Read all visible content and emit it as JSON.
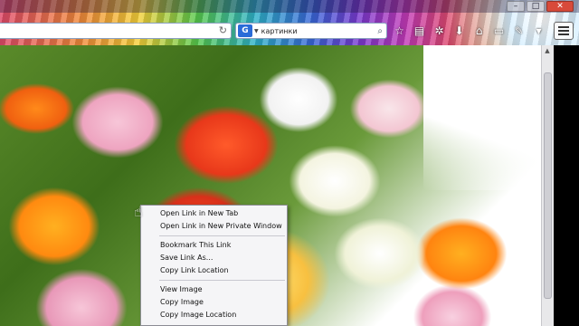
{
  "browser": {
    "window_controls": [
      "–",
      "□",
      "✕"
    ]
  },
  "search": {
    "engine_icon_label": "G",
    "value": "картинки",
    "engine_icon": "google-icon"
  },
  "toolbar_icons": [
    {
      "name": "star-icon",
      "glyph": "☆"
    },
    {
      "name": "clipboard-icon",
      "glyph": "▤"
    },
    {
      "name": "gear-icon",
      "glyph": "✲"
    },
    {
      "name": "download-icon",
      "glyph": "⬇"
    },
    {
      "name": "home-icon",
      "glyph": "⌂"
    },
    {
      "name": "chat-icon",
      "glyph": "▭"
    },
    {
      "name": "brush-icon",
      "glyph": "✎"
    },
    {
      "name": "dropdown-icon",
      "glyph": "▾"
    }
  ],
  "context_menu": {
    "items": [
      "Open Link in New Tab",
      "Open Link in New Private Window",
      "Bookmark This Link",
      "Save Link As...",
      "Copy Link Location",
      "View Image",
      "Copy Image",
      "Copy Image Location"
    ]
  },
  "colors": {
    "menu_background": "#f5f5f7",
    "menu_border": "#8c8c94"
  }
}
